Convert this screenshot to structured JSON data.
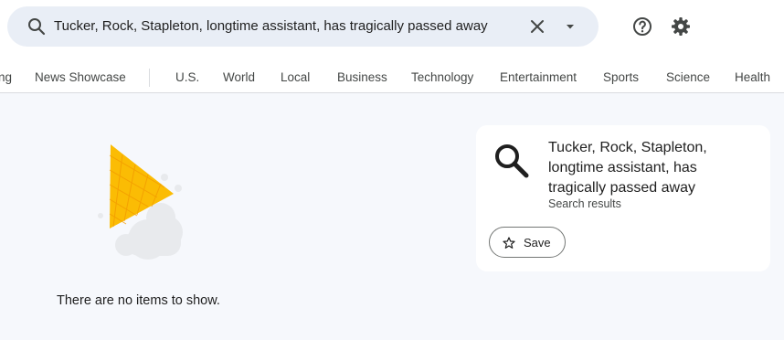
{
  "search": {
    "query": "Tucker, Rock, Stapleton, longtime assistant, has tragically passed away",
    "search_icon": "search-icon",
    "clear_icon": "close-icon",
    "options_icon": "arrow-drop-down-icon"
  },
  "header_actions": {
    "help_icon": "help-circle-icon",
    "settings_icon": "gear-icon"
  },
  "nav": {
    "partial_item": "ng",
    "items": [
      "News Showcase",
      "U.S.",
      "World",
      "Local",
      "Business",
      "Technology",
      "Entertainment",
      "Sports",
      "Science",
      "Health"
    ]
  },
  "empty_state": {
    "illustration": "ice-cream-cone-illustration",
    "message": "There are no items to show."
  },
  "result_card": {
    "icon": "search-icon",
    "title": "Tucker, Rock, Stapleton, longtime assistant, has tragically passed away",
    "subtitle": "Search results",
    "save_label": "Save",
    "save_icon": "star-outline-icon"
  },
  "colors": {
    "page_background": "#f6f8fc",
    "searchbox_background": "#e9eef6",
    "cone_yellow": "#fbbc04"
  }
}
